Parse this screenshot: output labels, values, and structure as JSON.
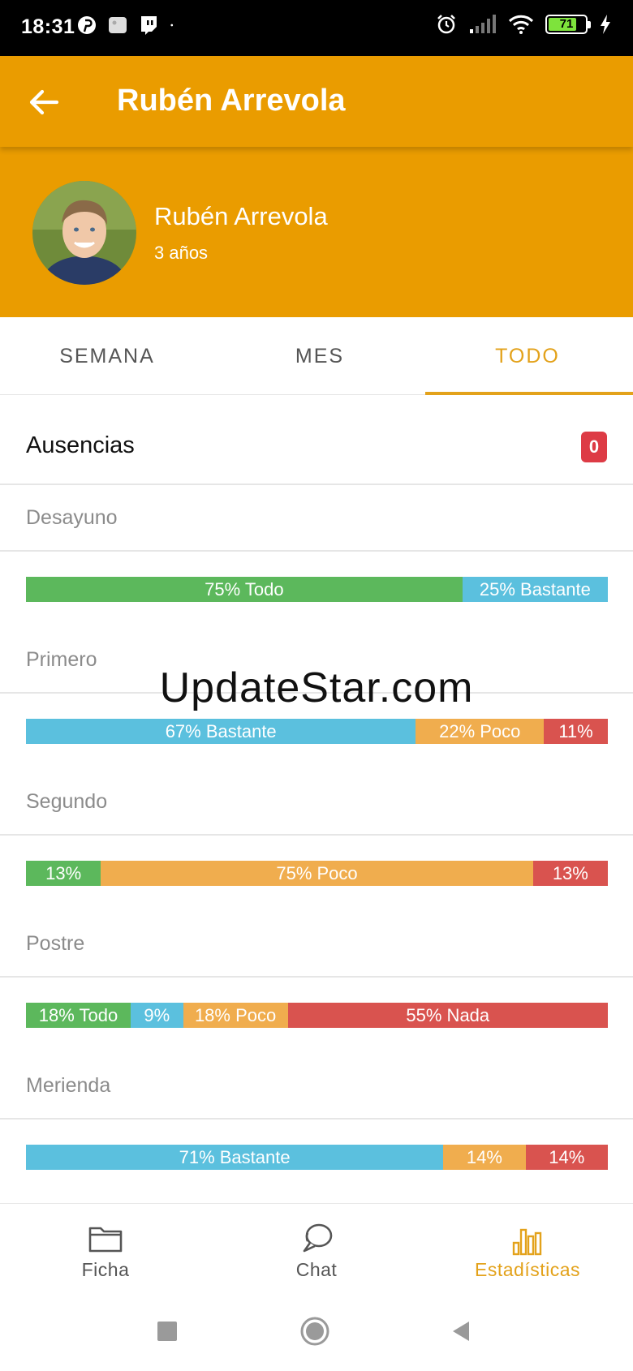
{
  "status_bar": {
    "time": "18:31",
    "battery": "71",
    "icons": [
      "pinterest-icon",
      "image-icon",
      "twitch-icon",
      "dot-icon",
      "alarm-icon",
      "signal-icon",
      "wifi-icon",
      "battery-icon",
      "charging-icon"
    ]
  },
  "app_bar": {
    "back_icon": "arrow-left-icon",
    "title": "Rubén Arrevola"
  },
  "profile": {
    "name": "Rubén Arrevola",
    "age": "3 años"
  },
  "tabs": [
    {
      "label": "SEMANA",
      "active": false
    },
    {
      "label": "MES",
      "active": false
    },
    {
      "label": "TODO",
      "active": true
    }
  ],
  "ausencias": {
    "label": "Ausencias",
    "count": "0"
  },
  "colors": {
    "accent": "#ea9c00",
    "tab_active": "#e3a21b",
    "todo": "#5cb85c",
    "bastante": "#5bc0de",
    "poco": "#f0ad4e",
    "nada": "#d9534f",
    "badge": "#dd3b45"
  },
  "meals": [
    {
      "label": "Desayuno",
      "segments": [
        {
          "category": "todo",
          "percent": 75,
          "text": "75% Todo"
        },
        {
          "category": "bastante",
          "percent": 25,
          "text": "25% Bastante"
        }
      ]
    },
    {
      "label": "Primero",
      "segments": [
        {
          "category": "bastante",
          "percent": 67,
          "text": "67% Bastante"
        },
        {
          "category": "poco",
          "percent": 22,
          "text": "22% Poco"
        },
        {
          "category": "nada",
          "percent": 11,
          "text": "11%"
        }
      ]
    },
    {
      "label": "Segundo",
      "segments": [
        {
          "category": "todo",
          "percent": 13,
          "text": "13%"
        },
        {
          "category": "poco",
          "percent": 75,
          "text": "75% Poco"
        },
        {
          "category": "nada",
          "percent": 13,
          "text": "13%"
        }
      ]
    },
    {
      "label": "Postre",
      "segments": [
        {
          "category": "todo",
          "percent": 18,
          "text": "18% Todo"
        },
        {
          "category": "bastante",
          "percent": 9,
          "text": "9%"
        },
        {
          "category": "poco",
          "percent": 18,
          "text": "18% Poco"
        },
        {
          "category": "nada",
          "percent": 55,
          "text": "55% Nada"
        }
      ]
    },
    {
      "label": "Merienda",
      "segments": [
        {
          "category": "bastante",
          "percent": 71,
          "text": "71% Bastante"
        },
        {
          "category": "poco",
          "percent": 14,
          "text": "14%"
        },
        {
          "category": "nada",
          "percent": 14,
          "text": "14%"
        }
      ]
    }
  ],
  "watermark": "UpdateStar.com",
  "bottom_nav": [
    {
      "label": "Ficha",
      "icon": "folder-icon",
      "active": false
    },
    {
      "label": "Chat",
      "icon": "chat-icon",
      "active": false
    },
    {
      "label": "Estadísticas",
      "icon": "bar-chart-icon",
      "active": true
    }
  ],
  "system_nav": [
    "recents-icon",
    "home-icon",
    "back-icon"
  ]
}
